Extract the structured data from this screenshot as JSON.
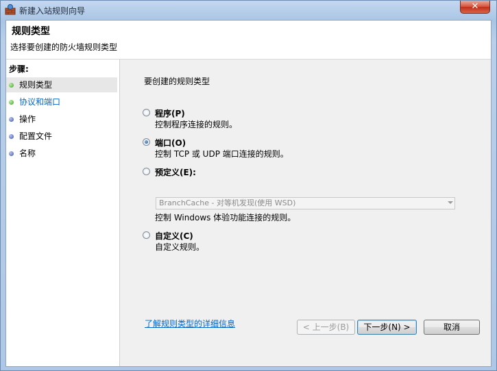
{
  "window": {
    "title": "新建入站规则向导",
    "close_label": "✕"
  },
  "header": {
    "title": "规则类型",
    "subtitle": "选择要创建的防火墙规则类型"
  },
  "steps": {
    "title": "步骤:",
    "items": [
      {
        "label": "规则类型",
        "state": "active",
        "dot": "green"
      },
      {
        "label": "协议和端口",
        "state": "link",
        "dot": "green"
      },
      {
        "label": "操作",
        "state": "normal",
        "dot": "blue"
      },
      {
        "label": "配置文件",
        "state": "normal",
        "dot": "blue"
      },
      {
        "label": "名称",
        "state": "normal",
        "dot": "blue"
      }
    ]
  },
  "main": {
    "question": "要创建的规则类型",
    "options": [
      {
        "label": "程序(P)",
        "desc": "控制程序连接的规则。",
        "checked": false
      },
      {
        "label": "端口(O)",
        "desc": "控制 TCP 或 UDP 端口连接的规则。",
        "checked": true
      },
      {
        "label": "预定义(E):",
        "desc": "控制 Windows 体验功能连接的规则。",
        "checked": false
      },
      {
        "label": "自定义(C)",
        "desc": "自定义规则。",
        "checked": false
      }
    ],
    "predefined_combo_value": "BranchCache - 对等机发现(使用 WSD)",
    "more_info_link": "了解规则类型的详细信息"
  },
  "buttons": {
    "back": "< 上一步(B)",
    "next": "下一步(N) >",
    "cancel": "取消"
  }
}
